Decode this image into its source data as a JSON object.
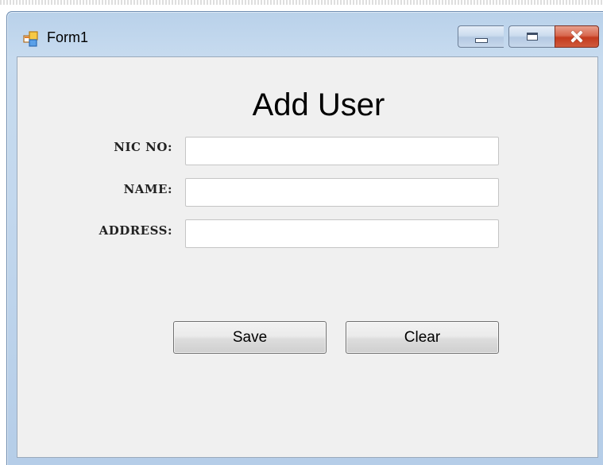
{
  "window": {
    "title": "Form1",
    "icon": "form-app-icon",
    "controls": {
      "minimize_icon": "minimize-icon",
      "maximize_icon": "maximize-icon",
      "close_icon": "close-icon"
    }
  },
  "form": {
    "heading": "Add User",
    "fields": [
      {
        "label": "NIC NO:",
        "value": "",
        "placeholder": ""
      },
      {
        "label": "NAME:",
        "value": "",
        "placeholder": ""
      },
      {
        "label": "ADDRESS:",
        "value": "",
        "placeholder": ""
      }
    ],
    "buttons": {
      "save": "Save",
      "clear": "Clear"
    }
  },
  "colors": {
    "title_bar": "#c3d8ee",
    "client_background": "#f0f0f0",
    "close_button": "#c33b1e"
  }
}
